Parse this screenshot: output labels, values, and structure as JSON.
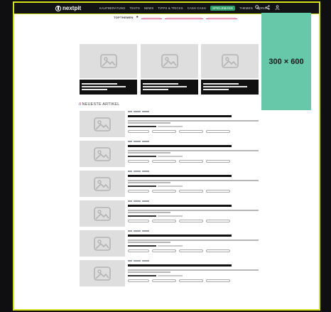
{
  "header": {
    "brand": "nextpit",
    "nav": [
      "KAUFBERATUNG",
      "TESTS",
      "NEWS",
      "TIPPS & TRICKS",
      "CASH CASH",
      "SPIELEMANN",
      "THEMEN",
      "FORUM"
    ],
    "active_nav": "SPIELEMANN",
    "icons": [
      "search-icon",
      "share-icon",
      "user-icon"
    ]
  },
  "topthemen": {
    "label": "TOPTHEMEN",
    "chips": [
      "———————",
      "——————————————",
      "———————————"
    ]
  },
  "ad": {
    "label": "300 × 600",
    "color": "#66c7a9"
  },
  "featured": [
    {
      "id": 1
    },
    {
      "id": 2
    },
    {
      "id": 3
    }
  ],
  "latest": {
    "heading_slash": "//",
    "heading": "NEUESTE ARTIKEL",
    "articles": [
      {
        "id": 1
      },
      {
        "id": 2
      },
      {
        "id": 3
      },
      {
        "id": 4
      },
      {
        "id": 5
      },
      {
        "id": 6
      }
    ]
  },
  "colors": {
    "frame": "#d8e21a",
    "nav_bg": "#111315",
    "accent": "#e0457b",
    "active_nav": "#2f9e6a"
  }
}
